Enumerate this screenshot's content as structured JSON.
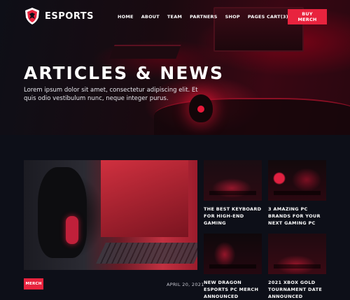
{
  "brand": {
    "name": "ESPORTS",
    "accent": "#e8233e",
    "logo_icon": "dragon-shield-icon"
  },
  "nav": {
    "items": [
      "HOME",
      "ABOUT",
      "TEAM",
      "PARTNERS",
      "SHOP",
      "PAGES"
    ],
    "cart": "CART(3)",
    "buy_label": "BUY MERCH"
  },
  "hero": {
    "title": "ARTICLES & NEWS",
    "subtitle": "Lorem ipsum dolor sit amet, consectetur adipiscing elit. Et quis odio vestibulum nunc, neque integer purus."
  },
  "featured": {
    "tag": "MERCH",
    "date": "APRIL 20, 2021"
  },
  "cards": [
    {
      "title": "THE BEST KEYBOARD FOR HIGH-END GAMING"
    },
    {
      "title": "3 AMAZING PC BRANDS FOR YOUR NEXT GAMING PC"
    },
    {
      "title": "NEW DRAGON ESPORTS PC MERCH ANNOUNCED"
    },
    {
      "title": "2021 XBOX GOLD TOURNAMENT DATE ANNOUNCED"
    }
  ]
}
